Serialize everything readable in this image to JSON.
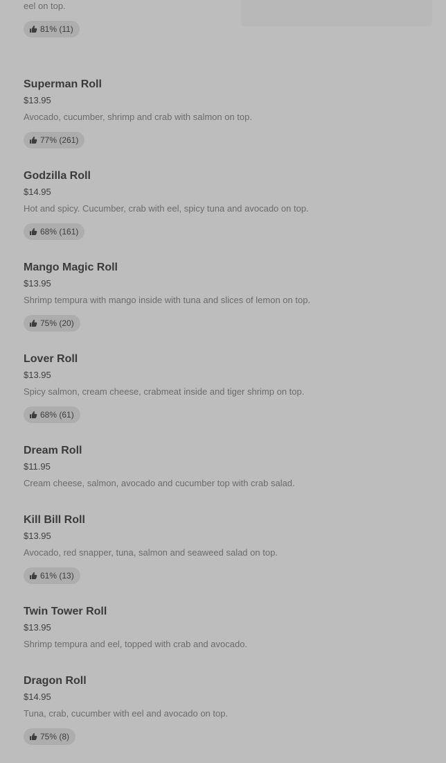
{
  "menu": {
    "items": [
      {
        "name": "",
        "price": "",
        "description": "eel on top.",
        "rating": "81% (11)",
        "has_photo": true
      },
      {
        "name": "Superman Roll",
        "price": "$13.95",
        "description": "Avocado, cucumber, shrimp and crab with salmon on top.",
        "rating": "77% (261)"
      },
      {
        "name": "Godzilla Roll",
        "price": "$14.95",
        "description": "Hot and spicy. Cucumber, crab with eel, spicy tuna and avocado on top.",
        "rating": "68% (161)"
      },
      {
        "name": "Mango Magic Roll",
        "price": "$13.95",
        "description": "Shrimp tempura with mango inside with tuna and slices of lemon on top.",
        "rating": "75% (20)"
      },
      {
        "name": "Lover Roll",
        "price": "$13.95",
        "description": "Spicy salmon, cream cheese, crabmeat inside and tiger shrimp on top.",
        "rating": "68% (61)"
      },
      {
        "name": "Dream Roll",
        "price": "$11.95",
        "description": "Cream cheese, salmon, avocado and cucumber top with crab salad.",
        "rating": ""
      },
      {
        "name": "Kill Bill Roll",
        "price": "$13.95",
        "description": "Avocado, red snapper, tuna, salmon and seaweed salad on top.",
        "rating": "61% (13)"
      },
      {
        "name": "Twin Tower Roll",
        "price": "$13.95",
        "description": "Shrimp tempura and eel, topped with crab and avocado.",
        "rating": ""
      },
      {
        "name": "Dragon Roll",
        "price": "$14.95",
        "description": "Tuna, crab, cucumber with eel and avocado on top.",
        "rating": "75% (8)"
      }
    ]
  },
  "icons": {
    "rating": "thumbs-up-icon"
  },
  "colors": {
    "background": "#bdbdbd",
    "rating_pill": "#adadad",
    "name_text": "#3a3a3a",
    "description_text": "#6b6b6b"
  }
}
